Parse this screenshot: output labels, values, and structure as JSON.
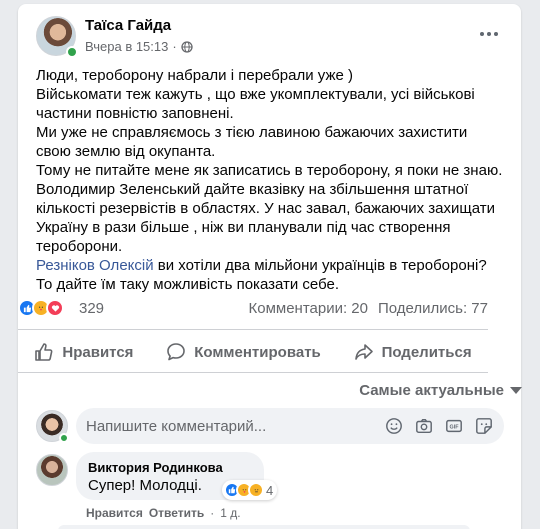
{
  "post": {
    "author": "Таїса Гайда",
    "time": "Вчера в 15:13",
    "separator": "·",
    "text_lines": [
      "Люди, тероборону набрали і перебрали уже )",
      "Військомати теж кажуть , що вже укомплектували, усі військові",
      "частини повністю заповнені.",
      "Ми уже не справляємось з тією лавиною бажаючих захистити",
      "свою землю від окупанта.",
      "Тому не питайте мене як записатись в тероборону, я поки не знаю.",
      "Володимир Зеленський дайте вказівку на збільшення штатної",
      "кількості резервістів в областях. У нас завал, бажаючих захищати",
      "Україну в рази більше , ніж ви планували під час створення",
      "тероборони."
    ],
    "mention": "Резніков Олексій",
    "mention_rest": " ви хотіли два мільйони українців в тероборонi?",
    "last_line": "То дайте їм таку можливість показати себе.",
    "reactions_count": "329",
    "comments": "Комментарии: 20",
    "shares": "Поделились: 77"
  },
  "actions": {
    "like": "Нравится",
    "comment": "Комментировать",
    "share": "Поделиться"
  },
  "sort_label": "Самые актуальные",
  "compose": {
    "placeholder": "Напишите комментарий..."
  },
  "comment": {
    "author": "Виктория Родинкова",
    "text": "Супер! Молодці.",
    "reactions_count": "4",
    "like_link": "Нравится",
    "reply_link": "Ответить",
    "dot": "·",
    "time": "1 д."
  },
  "colors": {
    "accent": "#1877f2",
    "mention": "#385898",
    "secondary_text": "#65676b",
    "online": "#31a24c"
  }
}
